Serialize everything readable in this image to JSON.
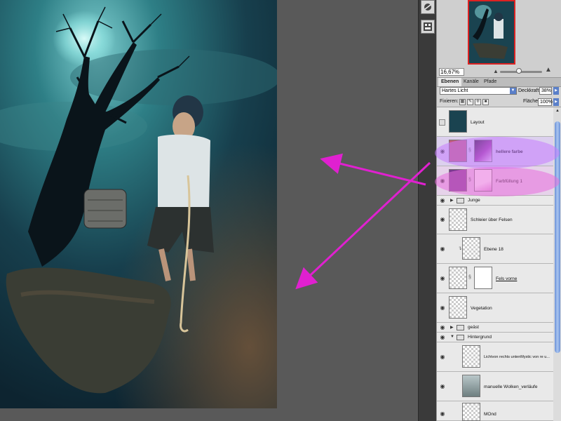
{
  "navigator": {
    "zoom": "16,67%",
    "zoom_fraction": 0.45
  },
  "toolstrip": {
    "icons": [
      "brush-presets-icon",
      "layer-comps-icon"
    ]
  },
  "layers_panel": {
    "tabs": [
      {
        "label": "Ebenen",
        "active": true
      },
      {
        "label": "Kanäle",
        "active": false
      },
      {
        "label": "Pfade",
        "active": false
      }
    ],
    "blend_mode": "Hartes Licht",
    "opacity_label": "Deckkraft:",
    "opacity": "38%",
    "lock_label": "Fixieren:",
    "fill_label": "Fläche:",
    "fill": "100%",
    "layers": [
      {
        "name": "Layout",
        "visible": false
      },
      {
        "name": "hellere farbe",
        "visible": true
      },
      {
        "name": "Farbfüllung 1",
        "visible": true
      },
      {
        "name": "Junge",
        "visible": true
      },
      {
        "name": "Schleier über Felsen",
        "visible": true
      },
      {
        "name": "Ebene 18",
        "visible": true
      },
      {
        "name": "Fels vorne",
        "visible": true
      },
      {
        "name": "Vegetation",
        "visible": true
      },
      {
        "name": "geäst",
        "visible": true
      },
      {
        "name": "Hintergrund",
        "visible": true
      },
      {
        "name": "Lichtvon rechts untenMystic von re u...",
        "visible": true
      },
      {
        "name": "manuelle Wolken_verläufe",
        "visible": true
      },
      {
        "name": "MOnd",
        "visible": true
      }
    ]
  },
  "colors": {
    "highlight_purple": "#c77bff",
    "highlight_pink": "#e86ddc",
    "arrow_magenta": "#e020d0",
    "panel_bg": "#d4d4d4"
  }
}
